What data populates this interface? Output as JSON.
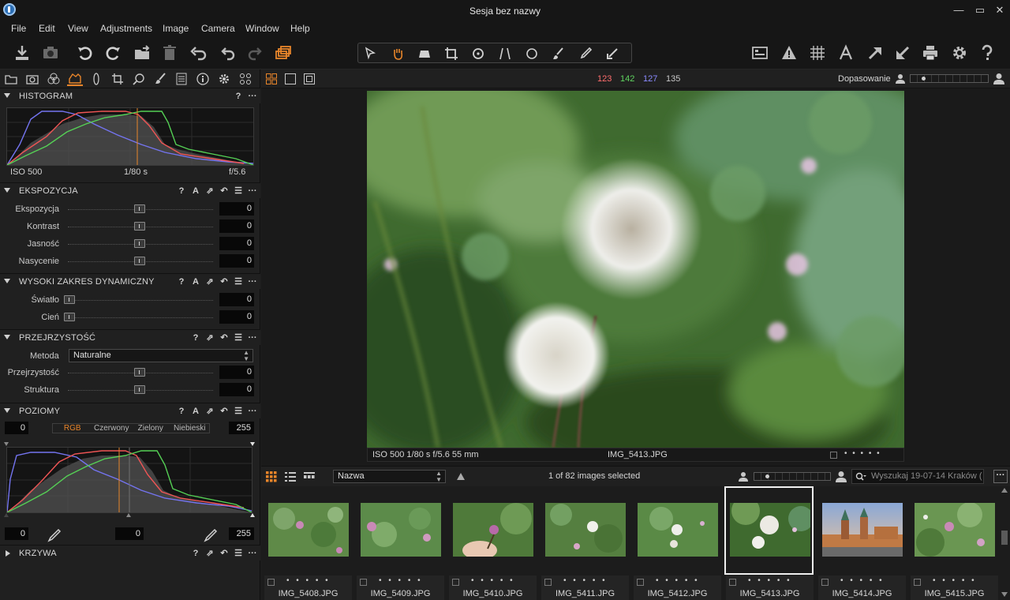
{
  "window": {
    "title": "Sesja bez nazwy",
    "minimize_glyph": "—",
    "maximize_glyph": "▭",
    "close_glyph": "✕"
  },
  "menu": [
    "File",
    "Edit",
    "View",
    "Adjustments",
    "Image",
    "Camera",
    "Window",
    "Help"
  ],
  "colors": {
    "accent": "#e8852a",
    "red": "#ff6d6d",
    "green": "#5fd35f",
    "blue": "#8a8aff",
    "panel": "#202020"
  },
  "histogram": {
    "title": "HISTOGRAM",
    "iso": "ISO 500",
    "shutter": "1/80 s",
    "aperture": "f/5.6",
    "help": "?",
    "more": "···"
  },
  "exposure": {
    "title": "EKSPOZYCJA",
    "sliders": [
      {
        "label": "Ekspozycja",
        "value": "0"
      },
      {
        "label": "Kontrast",
        "value": "0"
      },
      {
        "label": "Jasność",
        "value": "0"
      },
      {
        "label": "Nasycenie",
        "value": "0"
      }
    ]
  },
  "hdr": {
    "title": "WYSOKI ZAKRES DYNAMICZNY",
    "sliders": [
      {
        "label": "Światło",
        "value": "0"
      },
      {
        "label": "Cień",
        "value": "0"
      }
    ]
  },
  "clarity": {
    "title": "PRZEJRZYSTOŚĆ",
    "method_label": "Metoda",
    "method_value": "Naturalne",
    "sliders": [
      {
        "label": "Przejrzystość",
        "value": "0"
      },
      {
        "label": "Struktura",
        "value": "0"
      }
    ]
  },
  "levels": {
    "title": "POZIOMY",
    "input_low": "0",
    "input_high": "255",
    "channels": [
      "RGB",
      "Czerwony",
      "Zielony",
      "Niebieski"
    ],
    "active_channel": "RGB",
    "output_low": "0",
    "output_mid": "0",
    "output_high": "255"
  },
  "curve": {
    "title": "KRZYWA"
  },
  "head_icons": {
    "help": "?",
    "auto": "A",
    "copy": "⇗",
    "reset": "↶",
    "menu": "☰",
    "more": "···"
  },
  "viewer_toolbar": {
    "r": "123",
    "g": "142",
    "b": "127",
    "l": "135",
    "fit_label": "Dopasowanie"
  },
  "photo": {
    "exif": "ISO 500  1/80 s  f/5.6  55 mm",
    "filename": "IMG_5413.JPG",
    "rating_dots": "• • • • •"
  },
  "browser": {
    "sort_value": "Nazwa",
    "selection_text": "1 of 82 images selected",
    "search_placeholder": "Wyszukaj 19-07-14 Kraków (",
    "more": "···",
    "thumbnails": [
      {
        "name": "IMG_5408.JPG",
        "dots": "• • • • •",
        "selected": false
      },
      {
        "name": "IMG_5409.JPG",
        "dots": "• • • • •",
        "selected": false
      },
      {
        "name": "IMG_5410.JPG",
        "dots": "• • • • •",
        "selected": false
      },
      {
        "name": "IMG_5411.JPG",
        "dots": "• • • • •",
        "selected": false
      },
      {
        "name": "IMG_5412.JPG",
        "dots": "• • • • •",
        "selected": false
      },
      {
        "name": "IMG_5413.JPG",
        "dots": "• • • • •",
        "selected": true
      },
      {
        "name": "IMG_5414.JPG",
        "dots": "• • • • •",
        "selected": false
      },
      {
        "name": "IMG_5415.JPG",
        "dots": "• • • • •",
        "selected": false
      }
    ]
  }
}
